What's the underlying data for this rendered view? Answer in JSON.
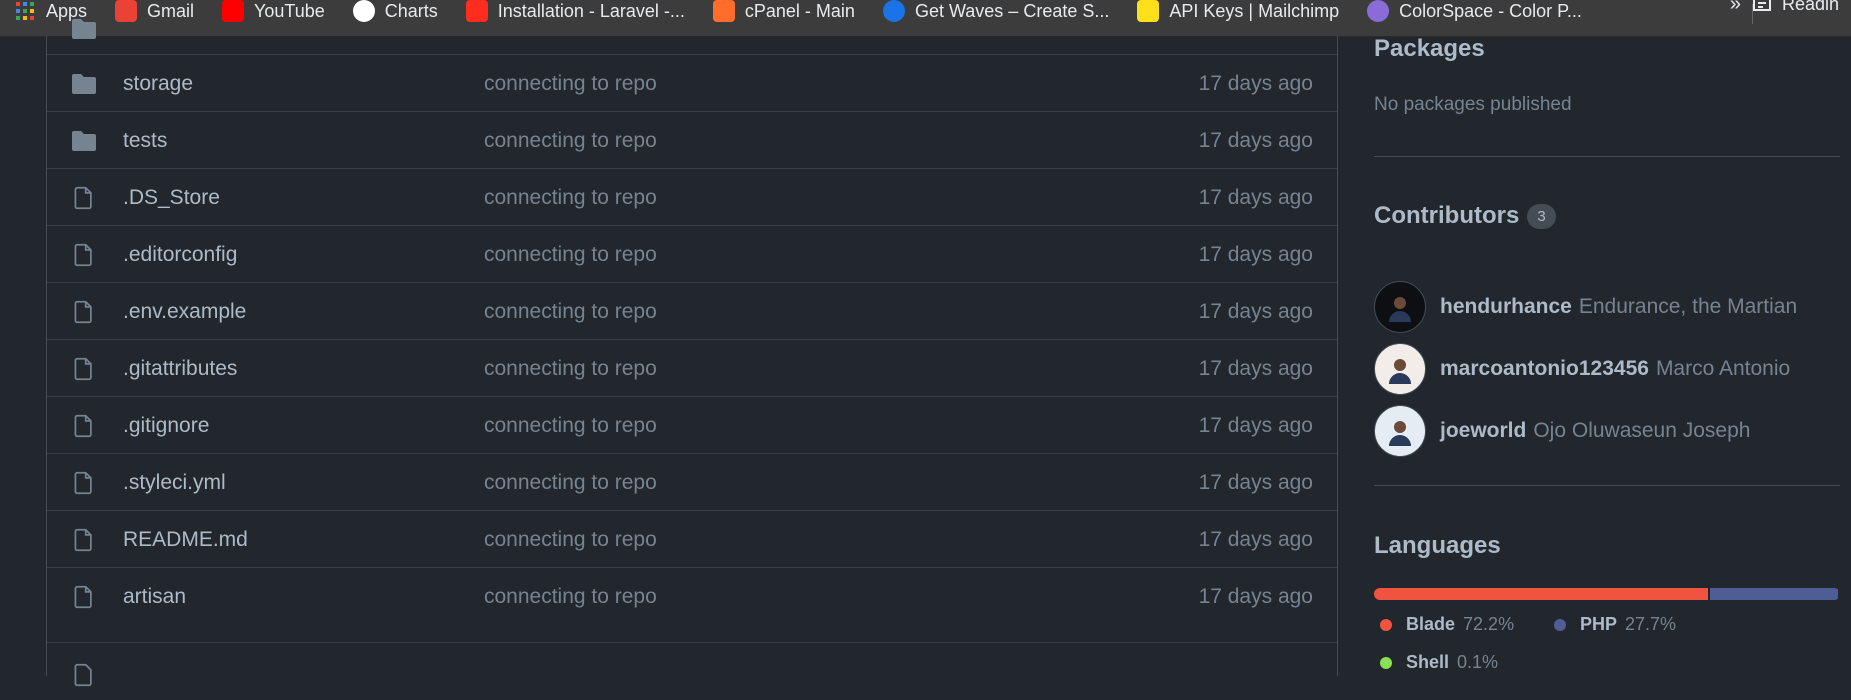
{
  "bookmarks": [
    {
      "label": "Apps",
      "icon": "apps-grid-icon",
      "color": "#4285f4"
    },
    {
      "label": "Gmail",
      "icon": "gmail-icon",
      "color": "#ea4335"
    },
    {
      "label": "YouTube",
      "icon": "youtube-icon",
      "color": "#ff0000"
    },
    {
      "label": "Charts",
      "icon": "globe-icon",
      "color": "#e8eaed"
    },
    {
      "label": "Installation - Laravel -...",
      "icon": "laravel-icon",
      "color": "#ff2d20"
    },
    {
      "label": "cPanel - Main",
      "icon": "cpanel-icon",
      "color": "#ff6c2c"
    },
    {
      "label": "Get Waves – Create S...",
      "icon": "waves-icon",
      "color": "#1a73e8"
    },
    {
      "label": "API Keys | Mailchimp",
      "icon": "mailchimp-icon",
      "color": "#ffe01b"
    },
    {
      "label": "ColorSpace - Color P...",
      "icon": "planet-icon",
      "color": "#8a6cd8"
    }
  ],
  "bookmarks_more": "»",
  "reading_list": "Readin",
  "files": [
    {
      "name": "storage",
      "message": "connecting to repo",
      "age": "17 days ago",
      "type": "folder"
    },
    {
      "name": "tests",
      "message": "connecting to repo",
      "age": "17 days ago",
      "type": "folder"
    },
    {
      "name": ".DS_Store",
      "message": "connecting to repo",
      "age": "17 days ago",
      "type": "file"
    },
    {
      "name": ".editorconfig",
      "message": "connecting to repo",
      "age": "17 days ago",
      "type": "file"
    },
    {
      "name": ".env.example",
      "message": "connecting to repo",
      "age": "17 days ago",
      "type": "file"
    },
    {
      "name": ".gitattributes",
      "message": "connecting to repo",
      "age": "17 days ago",
      "type": "file"
    },
    {
      "name": ".gitignore",
      "message": "connecting to repo",
      "age": "17 days ago",
      "type": "file"
    },
    {
      "name": ".styleci.yml",
      "message": "connecting to repo",
      "age": "17 days ago",
      "type": "file"
    },
    {
      "name": "README.md",
      "message": "connecting to repo",
      "age": "17 days ago",
      "type": "file"
    },
    {
      "name": "artisan",
      "message": "connecting to repo",
      "age": "17 days ago",
      "type": "file"
    }
  ],
  "sidebar": {
    "packages_heading": "Packages",
    "packages_text": "No packages published",
    "contributors_heading": "Contributors",
    "contributors_count": "3",
    "contributors": [
      {
        "login": "hendurhance",
        "name": "Endurance, the Martian",
        "avatar_color": "#0d0f12"
      },
      {
        "login": "marcoantonio123456",
        "name": "Marco Antonio",
        "avatar_color": "#f2ede8"
      },
      {
        "login": "joeworld",
        "name": "Ojo Oluwaseun Joseph",
        "avatar_color": "#e4ecf4"
      }
    ],
    "languages_heading": "Languages",
    "languages": [
      {
        "name": "Blade",
        "percent": "72.2%",
        "share": 72.2,
        "color": "#f05340"
      },
      {
        "name": "PHP",
        "percent": "27.7%",
        "share": 27.7,
        "color": "#4f5d95"
      },
      {
        "name": "Shell",
        "percent": "0.1%",
        "share": 0.1,
        "color": "#89e051"
      }
    ]
  }
}
